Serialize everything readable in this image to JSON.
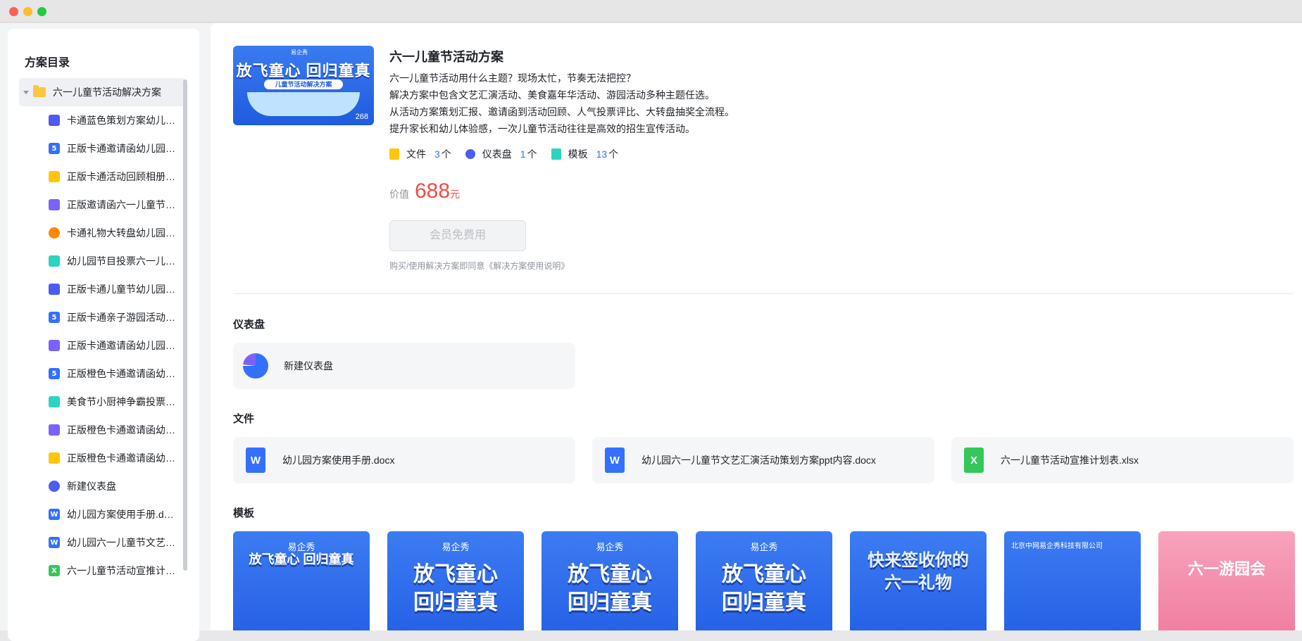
{
  "sidebar": {
    "title": "方案目录",
    "root": {
      "label": "六一儿童节活动解决方案"
    },
    "items": [
      {
        "label": "卡通蓝色策划方案幼儿园六一儿童节",
        "icon": "book-icon",
        "color": "#4e5bf2",
        "glyph": ""
      },
      {
        "label": "正版卡通邀请函幼儿园六一儿童节",
        "icon": "h5-icon",
        "color": "#3370ff",
        "glyph": "5"
      },
      {
        "label": "正版卡通活动回顾相册六一儿童节",
        "icon": "doc-icon",
        "color": "#ffc60a",
        "glyph": ""
      },
      {
        "label": "正版邀请函六一儿童节活动",
        "icon": "image-icon",
        "color": "#7b61ff",
        "glyph": ""
      },
      {
        "label": "卡通礼物大转盘幼儿园六一儿童节",
        "icon": "wheel-icon",
        "color": "#ff8800",
        "glyph": ""
      },
      {
        "label": "幼儿园节目投票六一儿童节",
        "icon": "form-icon",
        "color": "#2dd4bf",
        "glyph": ""
      },
      {
        "label": "正版卡通儿童节幼儿园活动",
        "icon": "book-icon",
        "color": "#4e5bf2",
        "glyph": ""
      },
      {
        "label": "正版卡通亲子游园活动六一",
        "icon": "h5-icon",
        "color": "#3370ff",
        "glyph": "5"
      },
      {
        "label": "正版卡通邀请函幼儿园六一",
        "icon": "image-icon",
        "color": "#7b61ff",
        "glyph": ""
      },
      {
        "label": "正版橙色卡通邀请函幼儿园",
        "icon": "h5-icon",
        "color": "#3370ff",
        "glyph": "5"
      },
      {
        "label": "美食节小厨神争霸投票活动",
        "icon": "form-icon",
        "color": "#2dd4bf",
        "glyph": ""
      },
      {
        "label": "正版橙色卡通邀请函幼儿园六一",
        "icon": "image-icon",
        "color": "#7b61ff",
        "glyph": ""
      },
      {
        "label": "正版橙色卡通邀请函幼儿园活动",
        "icon": "doc-icon",
        "color": "#ffc60a",
        "glyph": ""
      },
      {
        "label": "新建仪表盘",
        "icon": "dashboard-icon",
        "color": "#4e5bf2",
        "glyph": ""
      },
      {
        "label": "幼儿园方案使用手册.docx",
        "icon": "word-icon",
        "color": "#3370ff",
        "glyph": "W"
      },
      {
        "label": "幼儿园六一儿童节文艺汇演活动策划方案ppt内容.docx",
        "icon": "word-icon",
        "color": "#3370ff",
        "glyph": "W"
      },
      {
        "label": "六一儿童节活动宣推计划表.xlsx",
        "icon": "excel-icon",
        "color": "#34c759",
        "glyph": "X"
      }
    ]
  },
  "solution": {
    "cover_title": "放飞童心 回归童真",
    "cover_subtitle": "儿童节活动解决方案",
    "cover_count": "268",
    "cover_logo": "易企秀",
    "title": "六一儿童节活动方案",
    "desc_lines": [
      "六一儿童节活动用什么主题？现场太忙，节奏无法把控？",
      "解决方案中包含文艺汇演活动、美食嘉年华活动、游园活动多种主题任选。",
      "从活动方案策划汇报、邀请函到活动回顾、人气投票评比、大转盘抽奖全流程。",
      "提升家长和幼儿体验感，一次儿童节活动往往是高效的招生宣传活动。"
    ],
    "stats": [
      {
        "label": "文件",
        "count": "3",
        "unit": "个"
      },
      {
        "label": "仪表盘",
        "count": "1",
        "unit": "个"
      },
      {
        "label": "模板",
        "count": "13",
        "unit": "个"
      }
    ],
    "price_label": "价值",
    "price": "688",
    "price_unit": "元",
    "member_button": "会员免费用",
    "agreement": "购买/使用解决方案即同意《解决方案使用说明》"
  },
  "sections": {
    "dashboard_title": "仪表盘",
    "dashboard_card": "新建仪表盘",
    "files_title": "文件",
    "files": [
      {
        "name": "幼儿园方案使用手册.docx",
        "glyph": "W",
        "color": "#3370ff"
      },
      {
        "name": "幼儿园六一儿童节文艺汇演活动策划方案ppt内容.docx",
        "glyph": "W",
        "color": "#3370ff"
      },
      {
        "name": "六一儿童节活动宣推计划表.xlsx",
        "glyph": "X",
        "color": "#34c759"
      }
    ],
    "templates_title": "模板",
    "templates": [
      {
        "text": "放飞童心 回归童真",
        "logo": "易企秀"
      },
      {
        "text": "放飞童心 回归童真",
        "logo": "易企秀"
      },
      {
        "text": "放飞童心 回归童真",
        "logo": "易企秀"
      },
      {
        "text": "放飞童心 回归童真",
        "logo": "易企秀"
      },
      {
        "text": "快来签收你的 六一礼物",
        "logo": ""
      },
      {
        "text": "",
        "logo": "北京中网易企秀科技有限公司"
      },
      {
        "text": "六一游园会",
        "logo": ""
      }
    ]
  }
}
